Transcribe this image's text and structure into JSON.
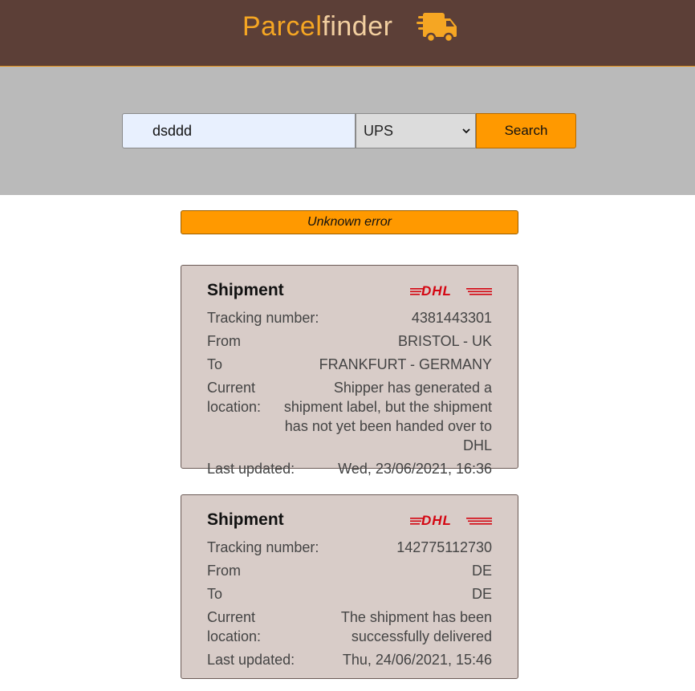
{
  "header": {
    "brand_part1": "Parcel",
    "brand_part2": "finder",
    "logo_icon": "truck-icon",
    "background": "#5c3f37",
    "accent": "#f5a623"
  },
  "search": {
    "value": "dsddd",
    "carrier_selected": "UPS",
    "button_label": "Search"
  },
  "error": {
    "message": "Unknown error"
  },
  "shipments": [
    {
      "title": "Shipment",
      "carrier_logo": "dhl-logo",
      "tracking_label": "Tracking number:",
      "tracking_number": "4381443301",
      "from_label": "From",
      "from": "BRISTOL - UK",
      "to_label": "To",
      "to": "FRANKFURT - GERMANY",
      "location_label": "Current location:",
      "location": "Shipper has generated a shipment label, but the shipment has not yet been handed over to DHL",
      "updated_label": "Last updated:",
      "updated": "Wed, 23/06/2021, 16:36"
    },
    {
      "title": "Shipment",
      "carrier_logo": "dhl-logo",
      "tracking_label": "Tracking number:",
      "tracking_number": "142775112730",
      "from_label": "From",
      "from": "DE",
      "to_label": "To",
      "to": "DE",
      "location_label": "Current location:",
      "location": "The shipment has been successfully delivered",
      "updated_label": "Last updated:",
      "updated": "Thu, 24/06/2021, 15:46"
    }
  ]
}
